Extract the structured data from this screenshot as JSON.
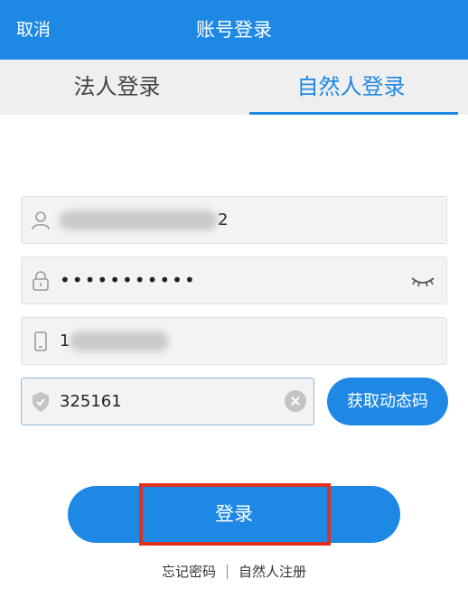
{
  "header": {
    "cancel_label": "取消",
    "title": "账号登录"
  },
  "tabs": [
    {
      "label": "法人登录",
      "active": false
    },
    {
      "label": "自然人登录",
      "active": true
    }
  ],
  "form": {
    "account": {
      "value_suffix": "2",
      "icon": "user-icon"
    },
    "password": {
      "value": "•••••••••••",
      "icon": "lock-icon",
      "toggle_icon": "eye-closed-icon"
    },
    "phone": {
      "value_prefix": "1",
      "icon": "phone-icon"
    },
    "sms_code": {
      "value": "325161",
      "icon": "shield-icon"
    },
    "get_code_label": "获取动态码",
    "login_label": "登录"
  },
  "footer": {
    "forgot_password": "忘记密码",
    "register": "自然人注册"
  },
  "colors": {
    "primary": "#1e88e5",
    "highlight": "#e0301e",
    "tab_bg": "#efefef",
    "field_bg": "#f3f3f3"
  }
}
